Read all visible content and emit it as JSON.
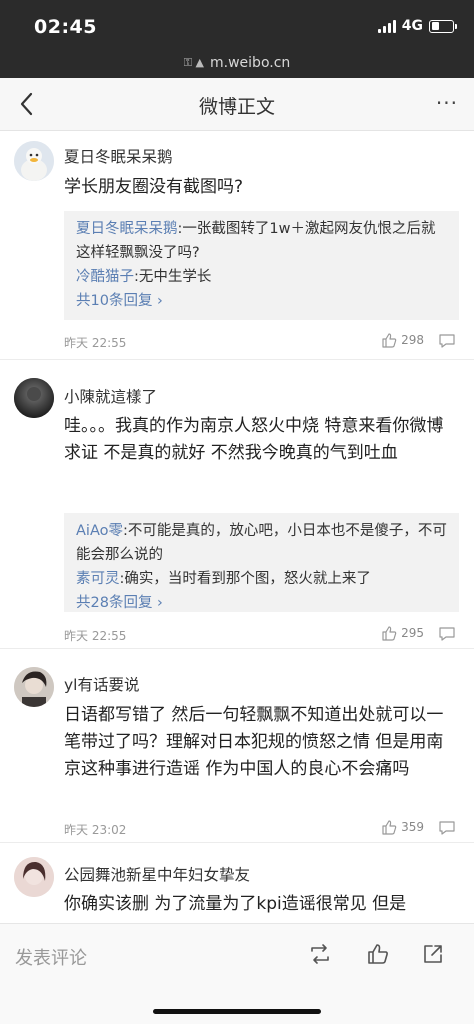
{
  "status_bar": {
    "time": "02:45",
    "network": "4G",
    "battery_level": 0.35
  },
  "url_bar": {
    "domain": "m.weibo.cn"
  },
  "nav": {
    "title": "微博正文",
    "more_icon": "more-dots-icon",
    "back_icon": "back-arrow-icon"
  },
  "comments": [
    {
      "user": "夏日冬眠呆呆鹅",
      "text": "学长朋友圈没有截图吗?",
      "replies": [
        {
          "name": "夏日冬眠呆呆鹅",
          "text": ":一张截图转了1w＋激起网友仇恨之后就这样轻飘飘没了吗?"
        },
        {
          "name": "冷酷猫子",
          "text": ":无中生学长"
        }
      ],
      "more_replies": "共10条回复",
      "time": "昨天 22:55",
      "likes": "298"
    },
    {
      "user": "小陳就這樣了",
      "text": "哇。。。我真的作为南京人怒火中烧 特意来看你微博求证 不是真的就好 不然我今晚真的气到吐血",
      "replies": [
        {
          "name": "AiAo零",
          "text": ":不可能是真的，放心吧，小日本也不是傻子，不可能会那么说的"
        },
        {
          "name": "素可灵",
          "text": ":确实，当时看到那个图，怒火就上来了"
        }
      ],
      "more_replies": "共28条回复",
      "time": "昨天 22:55",
      "likes": "295"
    },
    {
      "user": "yl有话要说",
      "text": "日语都写错了 然后一句轻飘飘不知道出处就可以一笔带过了吗？理解对日本犯规的愤怒之情 但是用南京这种事进行造谣 作为中国人的良心不会痛吗",
      "time": "昨天 23:02",
      "likes": "359"
    },
    {
      "user": "公园舞池新星中年妇女挚友",
      "text": "你确实该删 为了流量为了kpi造谣很常见 但是"
    }
  ],
  "bottom_bar": {
    "comment_placeholder": "发表评论"
  },
  "colors": {
    "link": "#5b7fb3",
    "status_bg": "#2b2b2b"
  }
}
